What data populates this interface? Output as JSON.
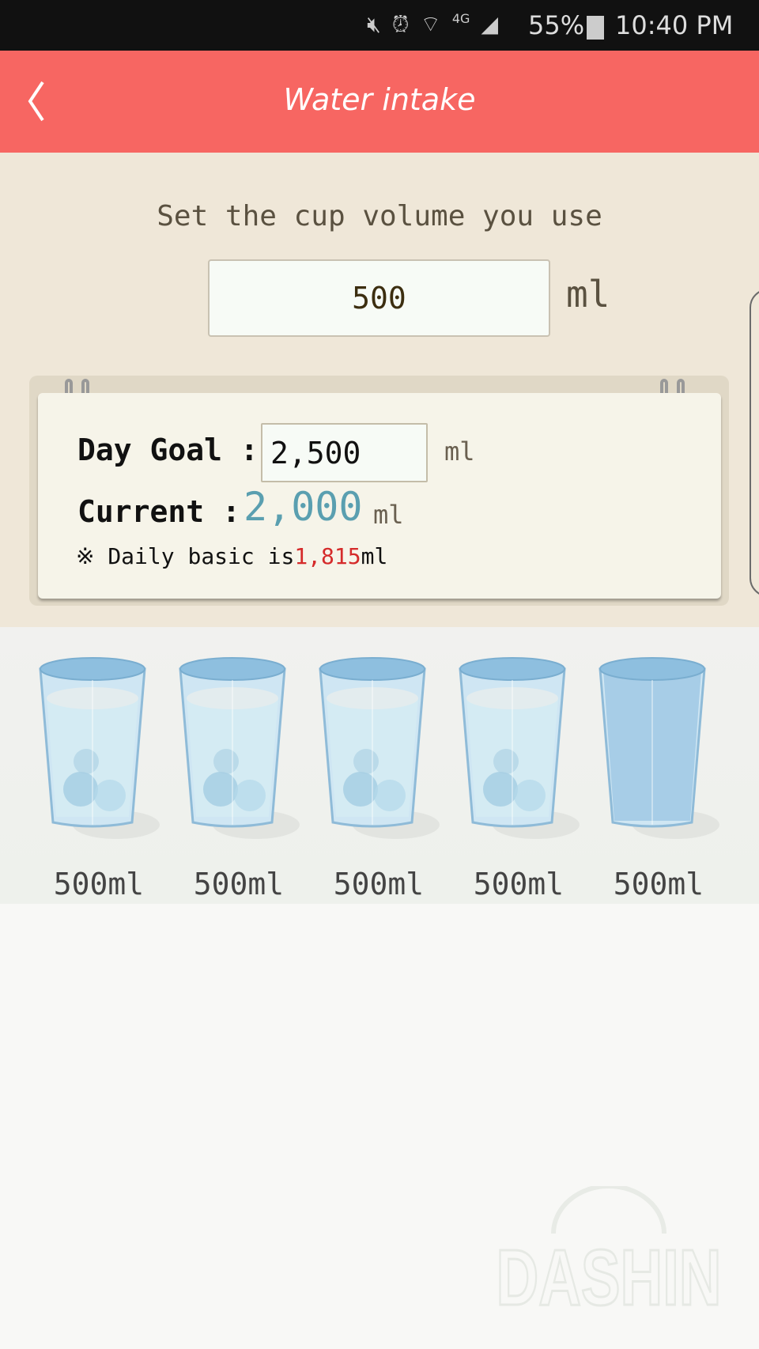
{
  "status_bar": {
    "battery": "55%",
    "time": "10:40 PM",
    "icons": [
      "mute-icon",
      "alarm-icon",
      "wifi-icon",
      "lte-icon",
      "signal-icon",
      "battery-icon"
    ]
  },
  "header": {
    "title": "Water intake",
    "back_icon": "chevron-left-icon",
    "color": "#f76662"
  },
  "cup_setup": {
    "label": "Set the cup volume you use",
    "value": "500",
    "unit": "ml"
  },
  "goal_card": {
    "day_goal_label": "Day Goal :",
    "day_goal_value": "2,500",
    "day_goal_unit": "ml",
    "current_label": "Current :",
    "current_value": "2,000",
    "current_unit": "ml",
    "current_color": "#5a9fb0",
    "note_prefix": "※ Daily basic is",
    "note_value": "1,815",
    "note_suffix": "ml",
    "note_value_color": "#d52b2b"
  },
  "cups": [
    {
      "label": "500ml",
      "filled": true
    },
    {
      "label": "500ml",
      "filled": true
    },
    {
      "label": "500ml",
      "filled": true
    },
    {
      "label": "500ml",
      "filled": true
    },
    {
      "label": "500ml",
      "filled": false
    }
  ],
  "watermark": "DASHIN"
}
